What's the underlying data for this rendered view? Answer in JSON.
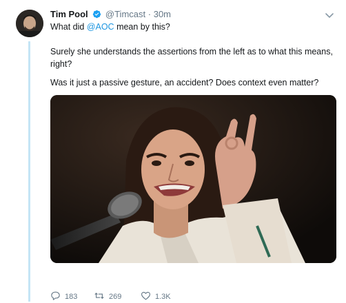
{
  "tweet": {
    "author_name": "Tim Pool",
    "handle": "@Timcast",
    "separator": "·",
    "time": "30m",
    "text_line1_before": "What did ",
    "mention": "@AOC",
    "text_line1_after": " mean by this?",
    "paragraph2": "Surely she understands the assertions from the left as to what this means, right?",
    "paragraph3": "Was it just a passive gesture, an accident? Does context even matter?"
  },
  "actions": {
    "replies": "183",
    "retweets": "269",
    "likes": "1.3K"
  },
  "colors": {
    "link": "#1b95e0",
    "verified": "#1da1f2",
    "muted": "#657786",
    "thread_line": "#c4e5f5"
  },
  "icons": [
    "verified-badge-icon",
    "chevron-down-icon",
    "reply-icon",
    "retweet-icon",
    "like-icon"
  ]
}
